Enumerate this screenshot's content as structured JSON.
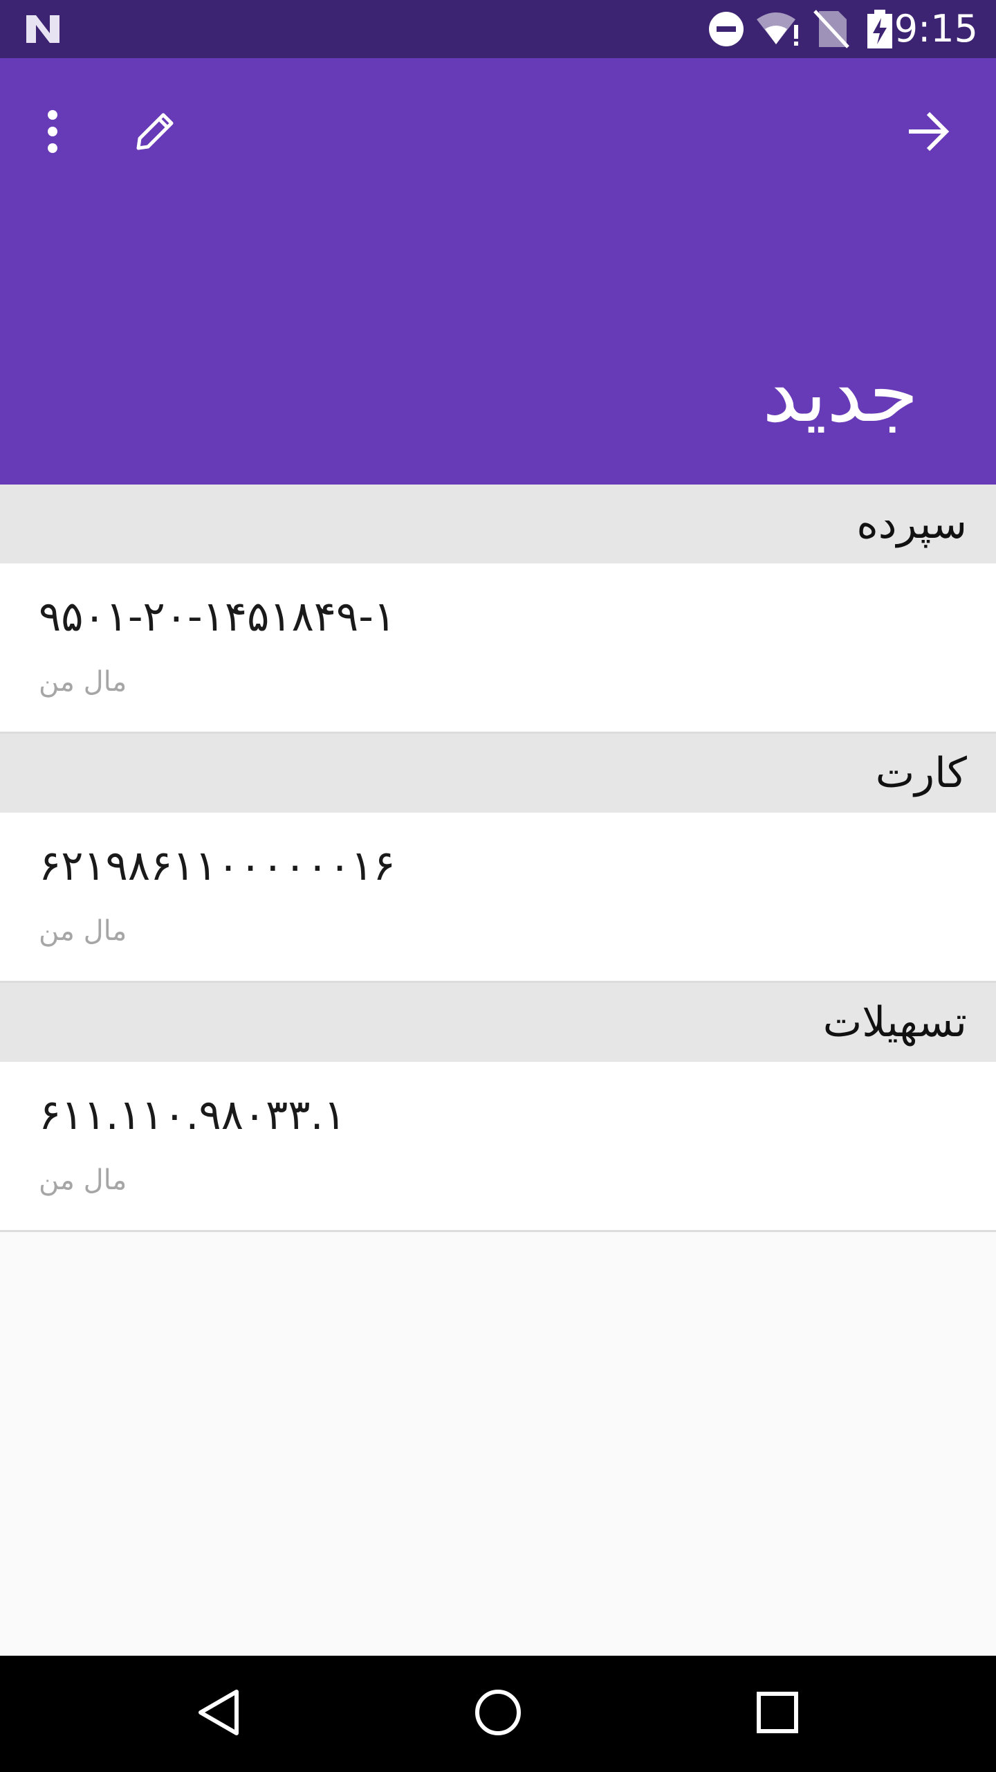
{
  "status_bar": {
    "time": "9:15",
    "icons": [
      "n-logo-icon",
      "do-not-disturb-icon",
      "wifi-alert-icon",
      "no-sim-icon",
      "battery-charging-icon"
    ]
  },
  "app_bar": {
    "title": "جدید",
    "actions": [
      "more-vert-icon",
      "edit-icon",
      "arrow-forward-icon"
    ]
  },
  "sections": [
    {
      "header": "سپرده",
      "item": {
        "number": "۹۵۰۱-۲۰-۱۴۵۱۸۴۹-۱",
        "owner": "مال من"
      }
    },
    {
      "header": "کارت",
      "item": {
        "number": "۶۲۱۹۸۶۱۱۰۰۰۰۰۰۱۶",
        "owner": "مال من"
      }
    },
    {
      "header": "تسهیلات",
      "item": {
        "number": "۶۱۱.۱۱۰.۹۸۰۳۳.۱",
        "owner": "مال من"
      }
    }
  ],
  "nav_bar": {
    "buttons": [
      "back-icon",
      "home-icon",
      "recents-icon"
    ]
  },
  "colors": {
    "primary": "#673ab7",
    "primary_dark": "#3c2472",
    "section_bg": "#e6e6e6",
    "secondary_text": "#a6a6a6"
  }
}
